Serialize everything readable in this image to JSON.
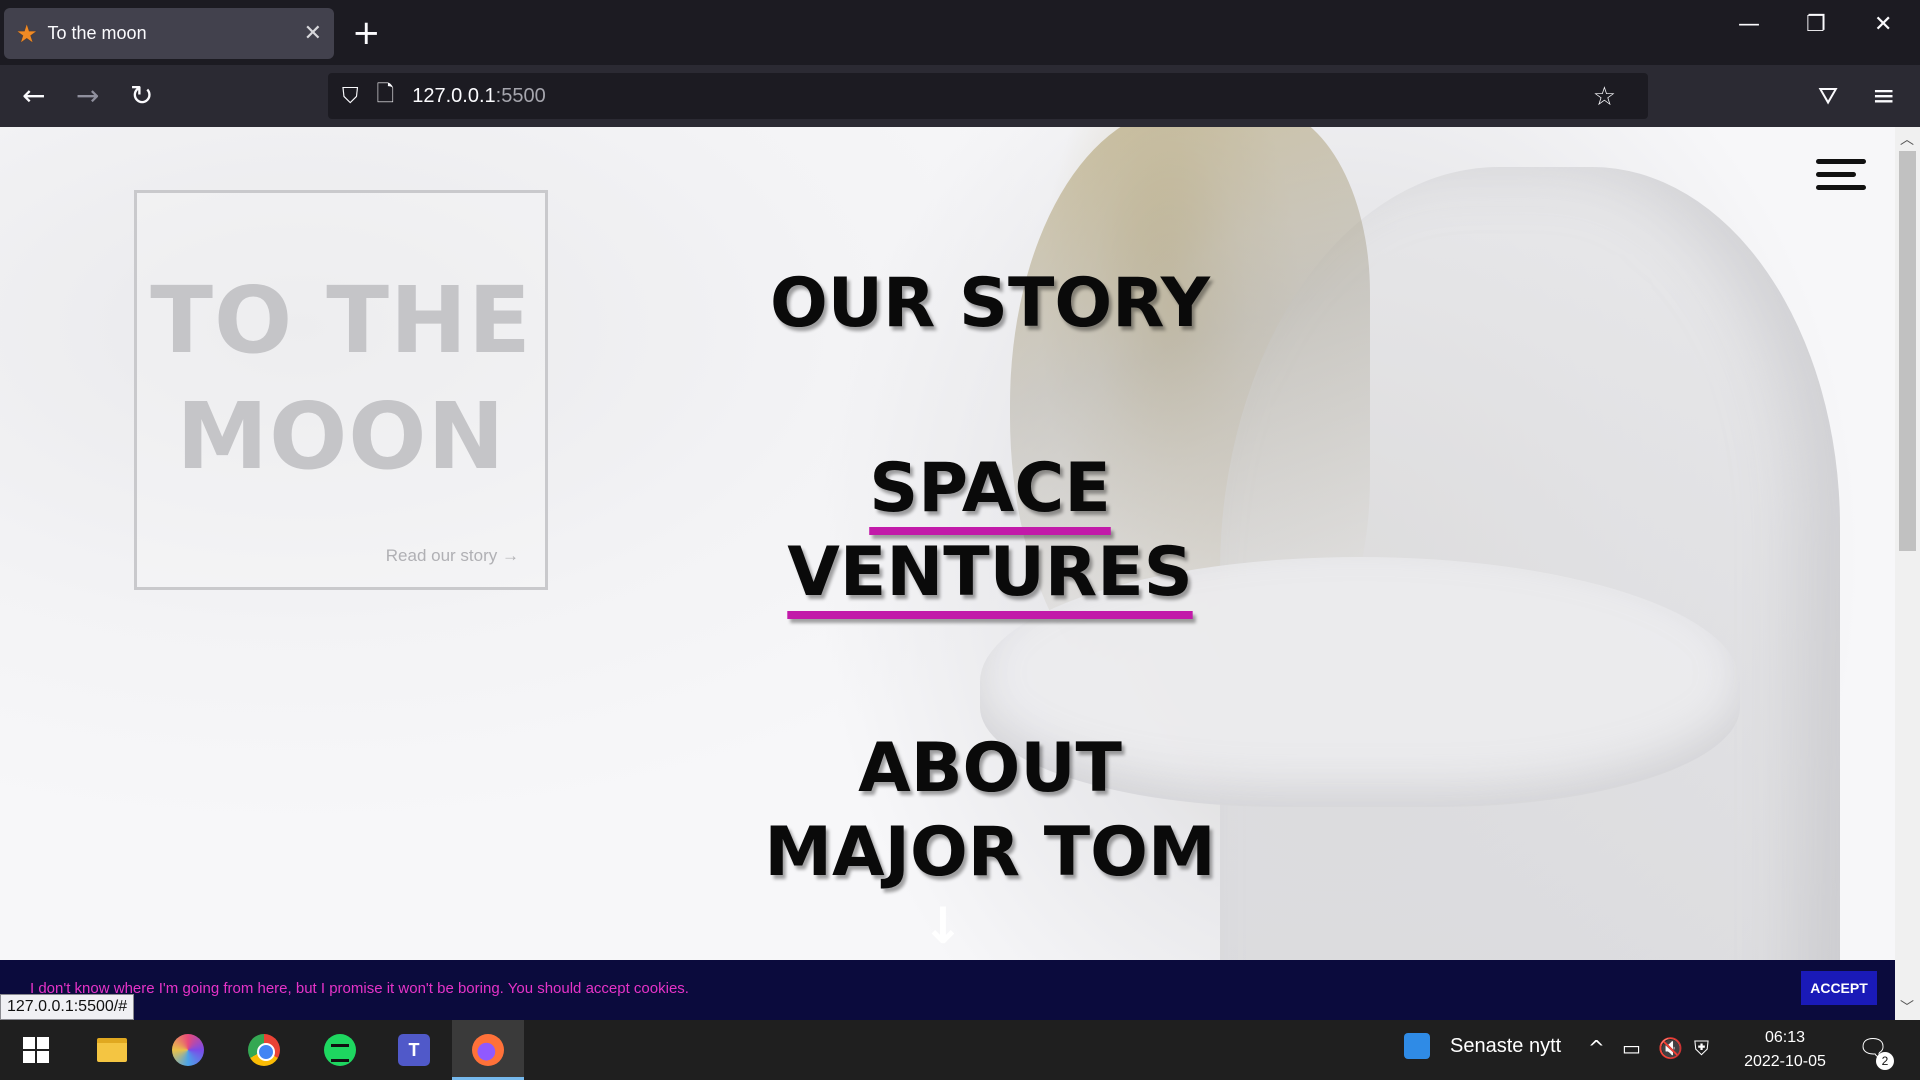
{
  "browser": {
    "tab_title": "To the moon",
    "url_host": "127.0.0.1",
    "url_port": ":5500"
  },
  "page": {
    "brand_title": "TO THE MOON",
    "read_story_link": "Read our story →",
    "menu_items": [
      {
        "label": "OUR STORY"
      },
      {
        "label": "SPACE VENTURES"
      },
      {
        "label": "ABOUT MAJOR TOM"
      }
    ],
    "down_arrow": "↓",
    "cookie_text": "I don't know where I'm going from here, but I promise it won't be boring. You should accept cookies.",
    "accept_label": "ACCEPT",
    "status_url": "127.0.0.1:5500/#"
  },
  "taskbar": {
    "news_label": "Senaste nytt",
    "time": "06:13",
    "date": "2022-10-05",
    "notification_count": "2"
  },
  "colors": {
    "accent_underline": "#c21aa9",
    "cookie_bar": "#0b0b3d",
    "cookie_text": "#e633c8",
    "accept_button": "#1a1ab8"
  },
  "icons": [
    "firefox-favicon-star",
    "close-icon",
    "plus-icon",
    "minimize-icon",
    "restore-icon",
    "back-icon",
    "forward-icon",
    "reload-icon",
    "shield-icon",
    "page-icon",
    "bookmark-star-icon",
    "pocket-icon",
    "app-menu-icon",
    "hamburger-icon",
    "down-arrow-icon"
  ]
}
